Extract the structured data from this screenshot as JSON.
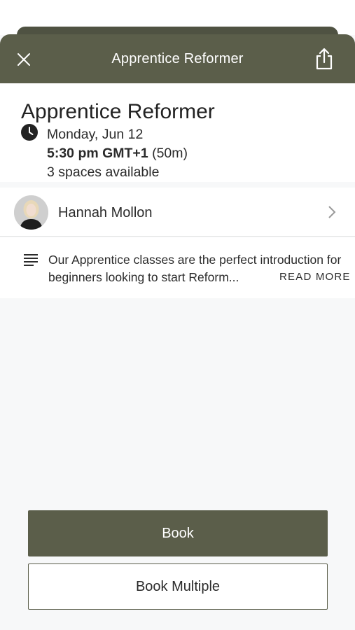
{
  "header": {
    "title": "Apprentice Reformer",
    "close_icon": "close-icon",
    "share_icon": "share-icon"
  },
  "class_info": {
    "title": "Apprentice Reformer",
    "date": "Monday, Jun 12",
    "time": "5:30 pm GMT+1",
    "duration": "(50m)",
    "spaces": "3 spaces available"
  },
  "instructor": {
    "name": "Hannah Mollon"
  },
  "description": {
    "text": "Our Apprentice classes are the perfect introduction for beginners looking to start Reform...",
    "read_more": "READ MORE"
  },
  "actions": {
    "book": "Book",
    "book_multiple": "Book Multiple"
  },
  "colors": {
    "header": "#5b5e4a",
    "background": "#f7f8f9"
  }
}
